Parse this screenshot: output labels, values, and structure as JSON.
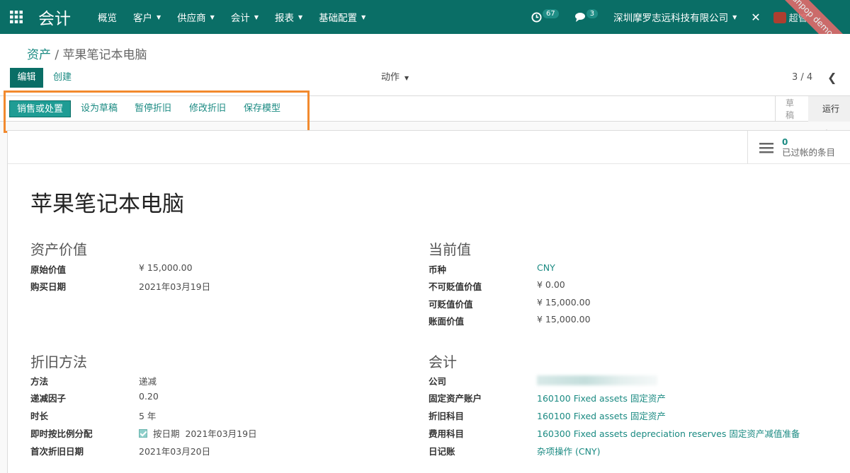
{
  "navbar": {
    "brand": "会计",
    "menus": [
      "概览",
      "客户",
      "供应商",
      "会计",
      "报表",
      "基础配置"
    ],
    "activity_count": "67",
    "message_count": "3",
    "company": "深圳摩罗志远科技有限公司",
    "user": "超管",
    "ribbon": "Sunpop demo erp"
  },
  "control": {
    "breadcrumb_parent": "资产",
    "breadcrumb_sep": "/",
    "breadcrumb_current": "苹果笔记本电脑",
    "edit_label": "编辑",
    "create_label": "创建",
    "action_label": "动作",
    "pager": "3 / 4"
  },
  "statusbar": {
    "buttons": [
      "销售或处置",
      "设为草稿",
      "暂停折旧",
      "修改折旧",
      "保存模型"
    ],
    "stages": [
      "草稿",
      "运行中"
    ]
  },
  "smart_button": {
    "count": "0",
    "label": "已过帐的条目"
  },
  "form": {
    "title": "苹果笔记本电脑",
    "asset_value": {
      "heading": "资产价值",
      "original_value_label": "原始价值",
      "original_value": "¥ 15,000.00",
      "purchase_date_label": "购买日期",
      "purchase_date": "2021年03月19日"
    },
    "current_value": {
      "heading": "当前值",
      "currency_label": "币种",
      "currency": "CNY",
      "non_dep_label": "不可贬值价值",
      "non_dep": "¥ 0.00",
      "dep_label": "可贬值价值",
      "dep": "¥ 15,000.00",
      "book_label": "账面价值",
      "book": "¥ 15,000.00"
    },
    "depreciation": {
      "heading": "折旧方法",
      "method_label": "方法",
      "method": "递减",
      "factor_label": "递减因子",
      "factor": "0.20",
      "duration_label": "时长",
      "duration": "5 年",
      "prorata_label": "即时按比例分配",
      "prorata_text": "按日期",
      "prorata_date": "2021年03月19日",
      "first_date_label": "首次折旧日期",
      "first_date": "2021年03月20日"
    },
    "accounting": {
      "heading": "会计",
      "company_label": "公司",
      "fixed_account_label": "固定资产账户",
      "fixed_account": "160100 Fixed assets 固定资产",
      "dep_account_label": "折旧科目",
      "dep_account": "160100 Fixed assets 固定资产",
      "expense_account_label": "费用科目",
      "expense_account": "160300 Fixed assets depreciation reserves 固定资产减值准备",
      "journal_label": "日记账",
      "journal": "杂项操作 (CNY)"
    }
  }
}
